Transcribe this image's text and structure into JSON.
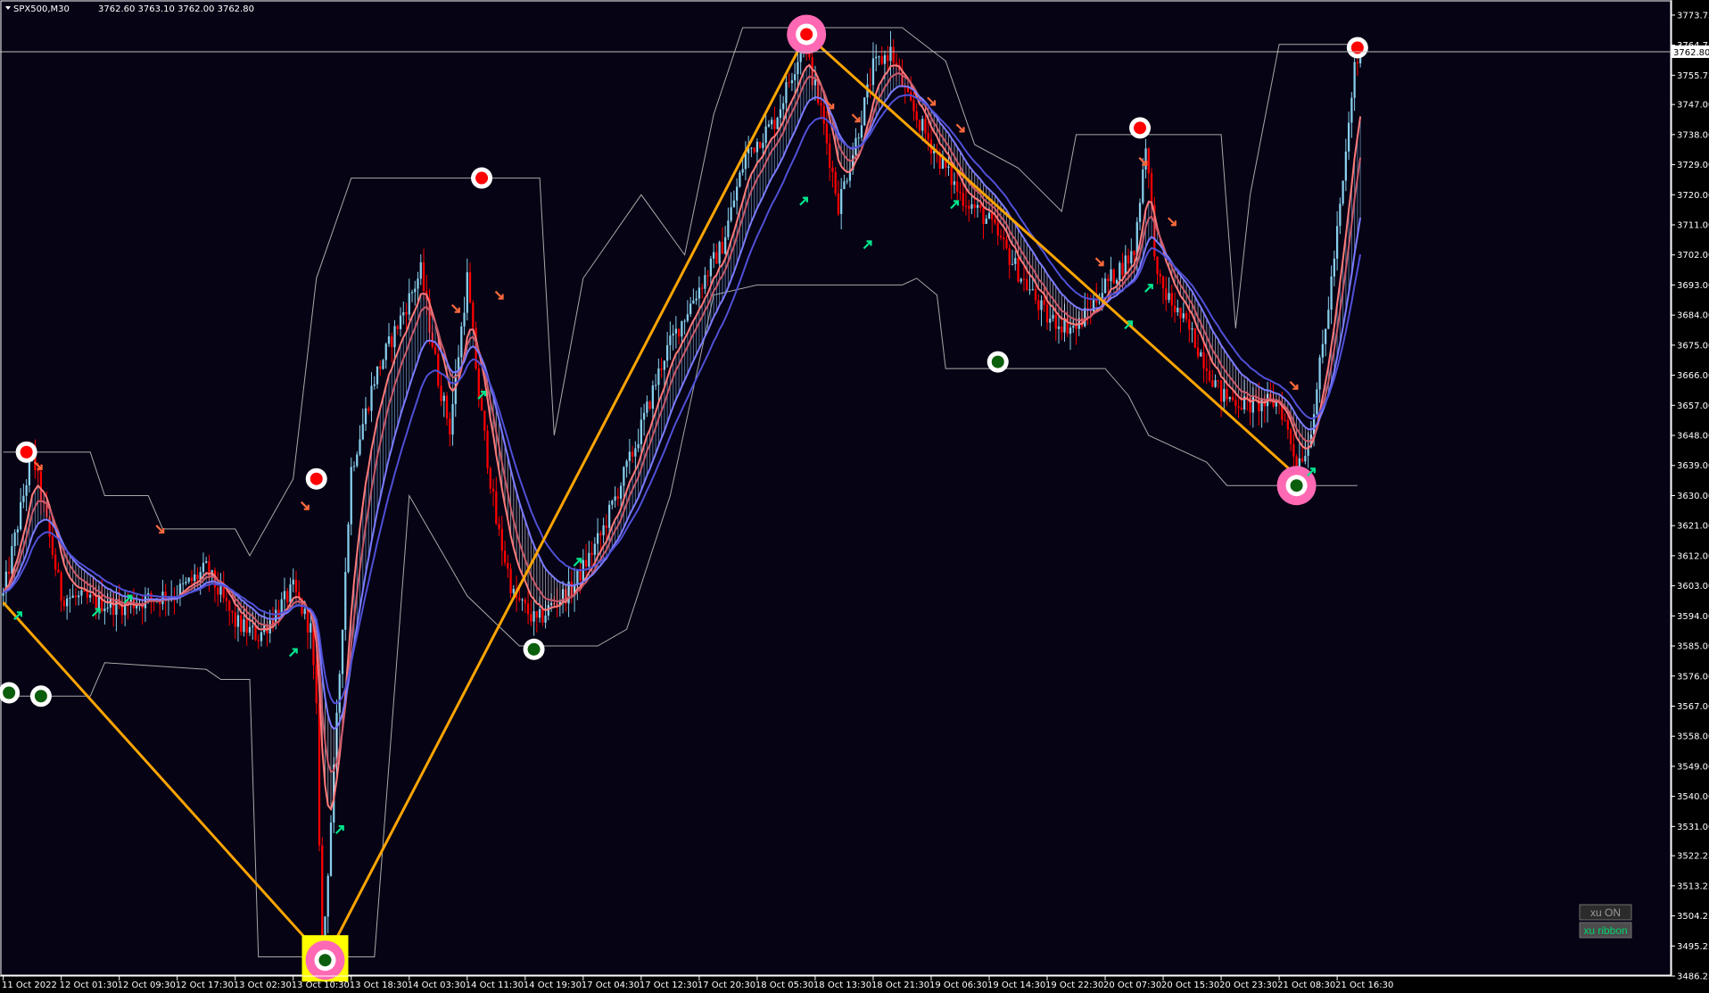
{
  "header": {
    "symbol": "SPX500,M30",
    "ohlc": "3762.60 3763.10 3762.00 3762.80"
  },
  "buttons": {
    "xu_on": "xu ON",
    "xu_ribbon": "xu ribbon"
  },
  "colors": {
    "background": "#000000",
    "plot_background": "#050314",
    "grid_frame": "#ffffff",
    "bull_candle": "#87ceeb",
    "bear_candle": "#ff0000",
    "channel": "#a9a9a9",
    "zigzag": "#ffa500",
    "fast_ribbon": "#ff6060",
    "slow_ribbon": "#6a6aff",
    "buy_arrow": "#00e58c",
    "sell_arrow": "#ff6a3d",
    "highlight_box": "#ffff00",
    "pivot_ring": "#ff69b4"
  },
  "chart_data": {
    "type": "candlestick",
    "symbol": "SPX500",
    "timeframe": "M30",
    "current_price": 3762.8,
    "ylim": [
      3486.25,
      3778
    ],
    "y_ticks": [
      "3773.75",
      "3764.75",
      "3755.75",
      "3747.00",
      "3738.00",
      "3729.00",
      "3720.00",
      "3711.00",
      "3702.00",
      "3693.00",
      "3684.00",
      "3675.00",
      "3666.00",
      "3657.00",
      "3648.00",
      "3639.00",
      "3630.00",
      "3621.00",
      "3612.00",
      "3603.00",
      "3594.00",
      "3585.00",
      "3576.00",
      "3567.00",
      "3558.00",
      "3549.00",
      "3540.00",
      "3531.00",
      "3522.25",
      "3513.25",
      "3504.25",
      "3495.25",
      "3486.25"
    ],
    "x_ticks": [
      "11 Oct 2022",
      "12 Oct 01:30",
      "12 Oct 09:30",
      "12 Oct 17:30",
      "13 Oct 02:30",
      "13 Oct 10:30",
      "13 Oct 18:30",
      "14 Oct 03:30",
      "14 Oct 11:30",
      "14 Oct 19:30",
      "17 Oct 04:30",
      "17 Oct 12:30",
      "17 Oct 20:30",
      "18 Oct 05:30",
      "18 Oct 13:30",
      "18 Oct 21:30",
      "19 Oct 06:30",
      "19 Oct 14:30",
      "19 Oct 22:30",
      "20 Oct 07:30",
      "20 Oct 15:30",
      "20 Oct 23:30",
      "21 Oct 08:30",
      "21 Oct 16:30"
    ],
    "price_path": [
      [
        0,
        3600
      ],
      [
        10,
        3643
      ],
      [
        20,
        3600
      ],
      [
        40,
        3597
      ],
      [
        60,
        3601
      ],
      [
        70,
        3608
      ],
      [
        80,
        3592
      ],
      [
        88,
        3588
      ],
      [
        100,
        3602
      ],
      [
        106,
        3590
      ],
      [
        108,
        3565
      ],
      [
        110,
        3490
      ],
      [
        114,
        3547
      ],
      [
        120,
        3638
      ],
      [
        128,
        3665
      ],
      [
        136,
        3681
      ],
      [
        144,
        3697
      ],
      [
        150,
        3665
      ],
      [
        154,
        3650
      ],
      [
        160,
        3695
      ],
      [
        164,
        3660
      ],
      [
        170,
        3622
      ],
      [
        176,
        3600
      ],
      [
        184,
        3592
      ],
      [
        190,
        3598
      ],
      [
        196,
        3602
      ],
      [
        206,
        3618
      ],
      [
        218,
        3645
      ],
      [
        228,
        3672
      ],
      [
        238,
        3689
      ],
      [
        248,
        3705
      ],
      [
        256,
        3732
      ],
      [
        266,
        3742
      ],
      [
        276,
        3766
      ],
      [
        282,
        3745
      ],
      [
        288,
        3717
      ],
      [
        294,
        3736
      ],
      [
        300,
        3758
      ],
      [
        306,
        3763
      ],
      [
        312,
        3748
      ],
      [
        320,
        3735
      ],
      [
        330,
        3720
      ],
      [
        340,
        3712
      ],
      [
        350,
        3697
      ],
      [
        360,
        3683
      ],
      [
        370,
        3680
      ],
      [
        380,
        3693
      ],
      [
        390,
        3703
      ],
      [
        394,
        3736
      ],
      [
        398,
        3694
      ],
      [
        410,
        3678
      ],
      [
        420,
        3660
      ],
      [
        430,
        3657
      ],
      [
        440,
        3658
      ],
      [
        446,
        3640
      ],
      [
        450,
        3645
      ],
      [
        456,
        3680
      ],
      [
        462,
        3723
      ],
      [
        466,
        3758
      ],
      [
        468,
        3763
      ]
    ],
    "zigzag": [
      [
        0,
        3598
      ],
      [
        111,
        3491
      ],
      [
        277,
        3768
      ],
      [
        446,
        3636
      ]
    ],
    "pivot_highs": [
      [
        8,
        3643
      ],
      [
        108,
        3635
      ],
      [
        165,
        3725
      ],
      [
        277,
        3768
      ],
      [
        392,
        3740
      ],
      [
        467,
        3764
      ]
    ],
    "pivot_lows": [
      [
        2,
        3571
      ],
      [
        13,
        3570
      ],
      [
        111,
        3491
      ],
      [
        183,
        3584
      ],
      [
        343,
        3670
      ],
      [
        446,
        3633
      ]
    ],
    "channel_upper": [
      [
        0,
        3643
      ],
      [
        30,
        3643
      ],
      [
        35,
        3630
      ],
      [
        50,
        3630
      ],
      [
        55,
        3620
      ],
      [
        80,
        3620
      ],
      [
        85,
        3612
      ],
      [
        100,
        3635
      ],
      [
        108,
        3695
      ],
      [
        120,
        3725
      ],
      [
        140,
        3725
      ],
      [
        144,
        3725
      ],
      [
        185,
        3725
      ],
      [
        190,
        3648
      ],
      [
        200,
        3695
      ],
      [
        220,
        3720
      ],
      [
        235,
        3702
      ],
      [
        245,
        3744
      ],
      [
        255,
        3770
      ],
      [
        285,
        3770
      ],
      [
        310,
        3770
      ],
      [
        325,
        3760
      ],
      [
        335,
        3735
      ],
      [
        350,
        3728
      ],
      [
        365,
        3715
      ],
      [
        370,
        3738
      ],
      [
        420,
        3738
      ],
      [
        425,
        3680
      ],
      [
        430,
        3720
      ],
      [
        440,
        3765
      ],
      [
        467,
        3765
      ]
    ],
    "channel_lower": [
      [
        0,
        3570
      ],
      [
        30,
        3570
      ],
      [
        35,
        3580
      ],
      [
        70,
        3578
      ],
      [
        75,
        3575
      ],
      [
        85,
        3575
      ],
      [
        88,
        3492
      ],
      [
        128,
        3492
      ],
      [
        140,
        3630
      ],
      [
        160,
        3600
      ],
      [
        178,
        3585
      ],
      [
        205,
        3585
      ],
      [
        215,
        3590
      ],
      [
        230,
        3630
      ],
      [
        245,
        3690
      ],
      [
        260,
        3693
      ],
      [
        275,
        3693
      ],
      [
        310,
        3693
      ],
      [
        315,
        3695
      ],
      [
        322,
        3690
      ],
      [
        325,
        3668
      ],
      [
        380,
        3668
      ],
      [
        388,
        3660
      ],
      [
        395,
        3648
      ],
      [
        415,
        3640
      ],
      [
        422,
        3633
      ],
      [
        467,
        3633
      ]
    ],
    "buy_arrows": [
      [
        5,
        3594
      ],
      [
        32,
        3595
      ],
      [
        43,
        3599
      ],
      [
        100,
        3583
      ],
      [
        116,
        3530
      ],
      [
        165,
        3660
      ],
      [
        198,
        3610
      ],
      [
        276,
        3718
      ],
      [
        298,
        3705
      ],
      [
        328,
        3717
      ],
      [
        388,
        3681
      ],
      [
        395,
        3692
      ],
      [
        451,
        3637
      ]
    ],
    "sell_arrows": [
      [
        12,
        3639
      ],
      [
        54,
        3620
      ],
      [
        104,
        3627
      ],
      [
        156,
        3686
      ],
      [
        171,
        3690
      ],
      [
        285,
        3747
      ],
      [
        294,
        3743
      ],
      [
        320,
        3748
      ],
      [
        330,
        3740
      ],
      [
        378,
        3700
      ],
      [
        393,
        3730
      ],
      [
        403,
        3712
      ],
      [
        445,
        3663
      ]
    ],
    "highlight_box_at": [
      111,
      3491
    ]
  }
}
